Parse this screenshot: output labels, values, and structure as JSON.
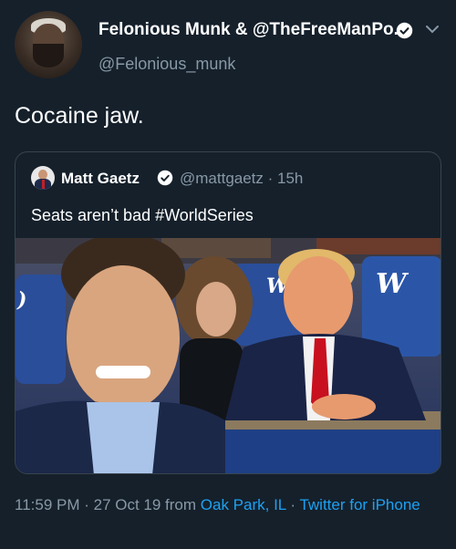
{
  "author": {
    "display_name": "Felonious Munk & @TheFreeManPo...",
    "handle": "@Felonious_munk"
  },
  "tweet": {
    "text": "Cocaine jaw."
  },
  "quoted_tweet": {
    "display_name": "Matt Gaetz",
    "handle_time": "@mattgaetz · 15h",
    "text": "Seats aren’t bad #WorldSeries",
    "photo_description_icon": "photo"
  },
  "footer": {
    "time": "11:59 PM · 27 Oct 19 from ",
    "location": "Oak Park, IL",
    "separator": " · ",
    "source": "Twitter for iPhone"
  },
  "colors": {
    "background": "#15202b",
    "secondary_text": "#8899a6",
    "link": "#1da1f2",
    "border": "#38444d"
  },
  "icons": [
    "verified-icon",
    "chevron-down-icon"
  ]
}
